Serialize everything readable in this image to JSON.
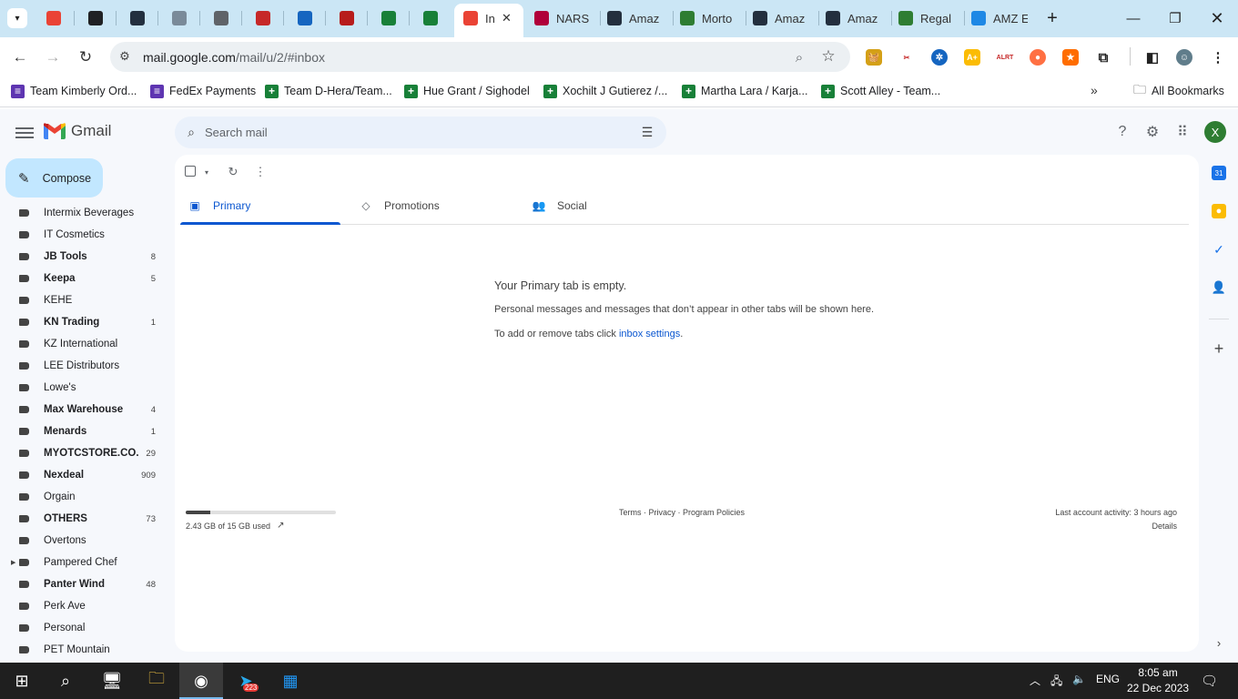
{
  "browser": {
    "tabs": [
      {
        "title": "",
        "icon": "gmail-icon",
        "color": "#EA4335"
      },
      {
        "title": "",
        "icon": "openai-icon",
        "color": "#202124"
      },
      {
        "title": "",
        "icon": "amazon-a-icon",
        "color": "#232F3E"
      },
      {
        "title": "",
        "icon": "graph-icon",
        "color": "#7a8a99"
      },
      {
        "title": "",
        "icon": "globe-icon",
        "color": "#5f6368"
      },
      {
        "title": "",
        "icon": "v-shield-icon",
        "color": "#c62828"
      },
      {
        "title": "",
        "icon": "compass-icon",
        "color": "#1565c0"
      },
      {
        "title": "",
        "icon": "vw-icon",
        "color": "#b71c1c"
      },
      {
        "title": "",
        "icon": "sheets-icon",
        "color": "#188038"
      },
      {
        "title": "",
        "icon": "sheets-icon",
        "color": "#188038"
      },
      {
        "title": "In",
        "icon": "gmail-icon",
        "color": "#EA4335",
        "active": true
      },
      {
        "title": "NARS",
        "icon": "k-icon",
        "color": "#b0003a"
      },
      {
        "title": "Amaz",
        "icon": "amazon-icon",
        "color": "#232F3E"
      },
      {
        "title": "Morto",
        "icon": "w-icon",
        "color": "#2e7d32"
      },
      {
        "title": "Amaz",
        "icon": "amazon-icon",
        "color": "#232F3E"
      },
      {
        "title": "Amaz",
        "icon": "amazon-icon",
        "color": "#232F3E"
      },
      {
        "title": "Regal",
        "icon": "w-icon",
        "color": "#2e7d32"
      },
      {
        "title": "AMZ E",
        "icon": "pen-icon",
        "color": "#1e88e5"
      }
    ],
    "url_host": "mail.google.com",
    "url_path": "/mail/u/2/#inbox",
    "bookmarks": [
      {
        "label": "Team Kimberly Ord...",
        "color": "#5e35b1"
      },
      {
        "label": "FedEx Payments",
        "color": "#5e35b1"
      },
      {
        "label": "Team D-Hera/Team...",
        "color": "#188038"
      },
      {
        "label": "Hue Grant / Sighodel",
        "color": "#188038"
      },
      {
        "label": "Xochilt J Gutierez /...",
        "color": "#188038"
      },
      {
        "label": "Martha Lara / Karja...",
        "color": "#188038"
      },
      {
        "label": "Scott Alley - Team...",
        "color": "#188038"
      }
    ],
    "all_bookmarks": "All Bookmarks"
  },
  "gmail": {
    "logo_text": "Gmail",
    "search_placeholder": "Search mail",
    "compose": "Compose",
    "avatar_letter": "X",
    "labels": [
      {
        "name": "Intermix Beverages",
        "count": "",
        "bold": false
      },
      {
        "name": "IT Cosmetics",
        "count": "",
        "bold": false
      },
      {
        "name": "JB Tools",
        "count": "8",
        "bold": true
      },
      {
        "name": "Keepa",
        "count": "5",
        "bold": true
      },
      {
        "name": "KEHE",
        "count": "",
        "bold": false
      },
      {
        "name": "KN Trading",
        "count": "1",
        "bold": true
      },
      {
        "name": "KZ International",
        "count": "",
        "bold": false
      },
      {
        "name": "LEE Distributors",
        "count": "",
        "bold": false
      },
      {
        "name": "Lowe's",
        "count": "",
        "bold": false
      },
      {
        "name": "Max Warehouse",
        "count": "4",
        "bold": true
      },
      {
        "name": "Menards",
        "count": "1",
        "bold": true
      },
      {
        "name": "MYOTCSTORE.CO...",
        "count": "29",
        "bold": true
      },
      {
        "name": "Nexdeal",
        "count": "909",
        "bold": true
      },
      {
        "name": "Orgain",
        "count": "",
        "bold": false
      },
      {
        "name": "OTHERS",
        "count": "73",
        "bold": true
      },
      {
        "name": "Overtons",
        "count": "",
        "bold": false
      },
      {
        "name": "Pampered Chef",
        "count": "",
        "bold": false,
        "expandable": true
      },
      {
        "name": "Panter Wind",
        "count": "48",
        "bold": true
      },
      {
        "name": "Perk Ave",
        "count": "",
        "bold": false
      },
      {
        "name": "Personal",
        "count": "",
        "bold": false
      },
      {
        "name": "PET Mountain",
        "count": "",
        "bold": false
      }
    ],
    "tabs": {
      "primary": "Primary",
      "promotions": "Promotions",
      "social": "Social"
    },
    "empty": {
      "title": "Your Primary tab is empty.",
      "desc": "Personal messages and messages that don’t appear in other tabs will be shown here.",
      "settings_prefix": "To add or remove tabs click ",
      "settings_link": "inbox settings",
      "settings_suffix": "."
    },
    "storage": {
      "text": "2.43 GB of 15 GB used",
      "used_fraction": 0.162
    },
    "footer_links": "Terms · Privacy · Program Policies",
    "last_activity": "Last account activity: 3 hours ago",
    "details": "Details"
  },
  "taskbar": {
    "lang": "ENG",
    "time": "8:05 am",
    "date": "22 Dec 2023",
    "telegram_badge": "223"
  }
}
